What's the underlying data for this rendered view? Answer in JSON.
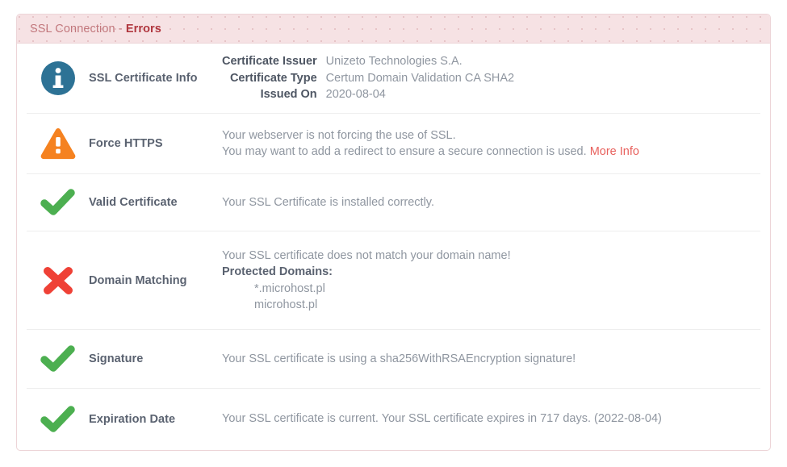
{
  "panel": {
    "header": {
      "title": "SSL Connection - ",
      "status": "Errors"
    }
  },
  "colors": {
    "header_bg": "#f6e2e4",
    "header_title": "#c2787d",
    "header_status": "#b0373f",
    "panel_border": "#edd5d8",
    "info_icon": "#2d7295",
    "warning_icon": "#f58220",
    "success_icon": "#4caf50",
    "error_icon": "#ef4136",
    "link": "#e8615d",
    "label_text": "#5a6270",
    "body_text": "#8f96a0"
  },
  "rows": [
    {
      "icon": "info-circle-icon",
      "label": "SSL Certificate Info",
      "details": [
        {
          "term": "Certificate Issuer",
          "value": "Unizeto Technologies S.A."
        },
        {
          "term": "Certificate Type",
          "value": "Certum Domain Validation CA SHA2"
        },
        {
          "term": "Issued On",
          "value": "2020-08-04"
        }
      ]
    },
    {
      "icon": "warning-triangle-icon",
      "label": "Force HTTPS",
      "line1": "Your webserver is not forcing the use of SSL.",
      "line2": "You may want to add a redirect to ensure a secure connection is used. ",
      "link_label": "More Info"
    },
    {
      "icon": "check-mark-icon",
      "label": "Valid Certificate",
      "line1": "Your SSL Certificate is installed correctly."
    },
    {
      "icon": "cross-mark-icon",
      "label": "Domain Matching",
      "line1": "Your SSL certificate does not match your domain name!",
      "subheading": "Protected Domains:",
      "domains": [
        "*.microhost.pl",
        "microhost.pl"
      ]
    },
    {
      "icon": "check-mark-icon",
      "label": "Signature",
      "line1": "Your SSL certificate is using a sha256WithRSAEncryption signature!"
    },
    {
      "icon": "check-mark-icon",
      "label": "Expiration Date",
      "line1": "Your SSL certificate is current. Your SSL certificate expires in 717 days. (2022-08-04)"
    }
  ]
}
